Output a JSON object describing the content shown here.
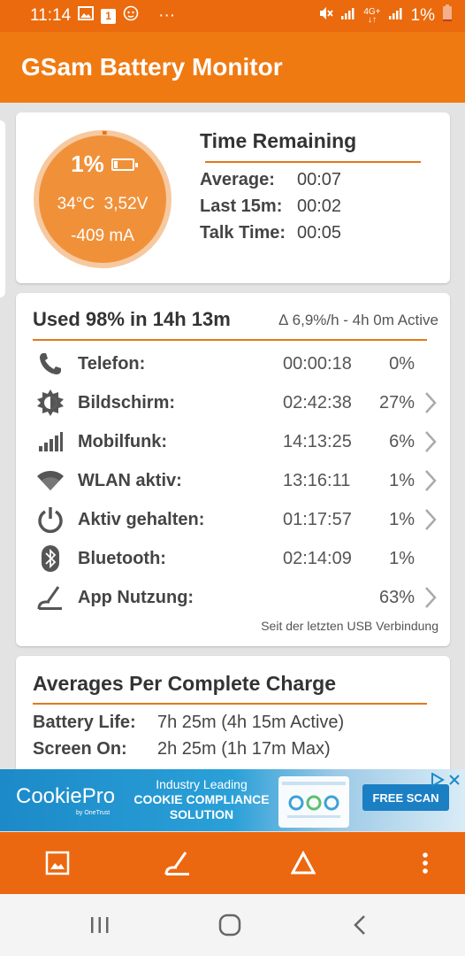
{
  "status_bar": {
    "time": "11:14",
    "notification_badge": "1",
    "more_dots": "···",
    "network_label_top": "4G+",
    "network_label_bottom": "↓↑",
    "battery_percent": "1%"
  },
  "app_bar": {
    "title": "GSam Battery Monitor"
  },
  "battery_card": {
    "gauge": {
      "percent": "1%",
      "level_fraction": 0.01,
      "temperature": "34°C",
      "voltage": "3,52V",
      "current": "-409 mA"
    },
    "time_remaining": {
      "title": "Time Remaining",
      "rows": [
        {
          "label": "Average:",
          "value": "00:07"
        },
        {
          "label": "Last 15m:",
          "value": "00:02"
        },
        {
          "label": "Talk Time:",
          "value": "00:05"
        }
      ]
    }
  },
  "usage_card": {
    "title": "Used 98% in 14h 13m",
    "subtitle": "∆ 6,9%/h - 4h 0m Active",
    "rows": [
      {
        "icon": "phone-icon",
        "label": "Telefon:",
        "time": "00:00:18",
        "percent": "0%",
        "chevron": false
      },
      {
        "icon": "brightness-icon",
        "label": "Bildschirm:",
        "time": "02:42:38",
        "percent": "27%",
        "chevron": true
      },
      {
        "icon": "signal-icon",
        "label": "Mobilfunk:",
        "time": "14:13:25",
        "percent": "6%",
        "chevron": true
      },
      {
        "icon": "wifi-icon",
        "label": "WLAN aktiv:",
        "time": "13:16:11",
        "percent": "1%",
        "chevron": true
      },
      {
        "icon": "power-icon",
        "label": "Aktiv gehalten:",
        "time": "01:17:57",
        "percent": "1%",
        "chevron": true
      },
      {
        "icon": "bluetooth-icon",
        "label": "Bluetooth:",
        "time": "02:14:09",
        "percent": "1%",
        "chevron": false
      },
      {
        "icon": "gauge-needle-icon",
        "label": "App Nutzung:",
        "time": "",
        "percent": "63%",
        "chevron": true
      }
    ],
    "footer": "Seit der letzten USB Verbindung"
  },
  "averages_card": {
    "title": "Averages Per Complete Charge",
    "rows": [
      {
        "label": "Battery Life:",
        "value": "7h 25m (4h 15m Active)"
      },
      {
        "label": "Screen On:",
        "value": "2h 25m (1h 17m Max)"
      }
    ]
  },
  "ad_banner": {
    "logo": "CookiePro",
    "logo_sub": "by OneTrust",
    "line1": "Industry Leading",
    "line2": "COOKIE COMPLIANCE",
    "line3": "SOLUTION",
    "button": "FREE SCAN"
  },
  "toolbar": {
    "items": [
      "image-icon",
      "gauge-needle-icon",
      "delta-icon",
      "overflow-menu-icon"
    ]
  },
  "nav_bar": {
    "items": [
      "recent-apps-icon",
      "home-icon",
      "back-icon"
    ]
  },
  "colors": {
    "app_orange": "#f07a12",
    "status_orange": "#ea6a0d",
    "toolbar_orange": "#ec6810",
    "gauge_fill": "#f0913a",
    "accent_line": "#e07a1c"
  }
}
